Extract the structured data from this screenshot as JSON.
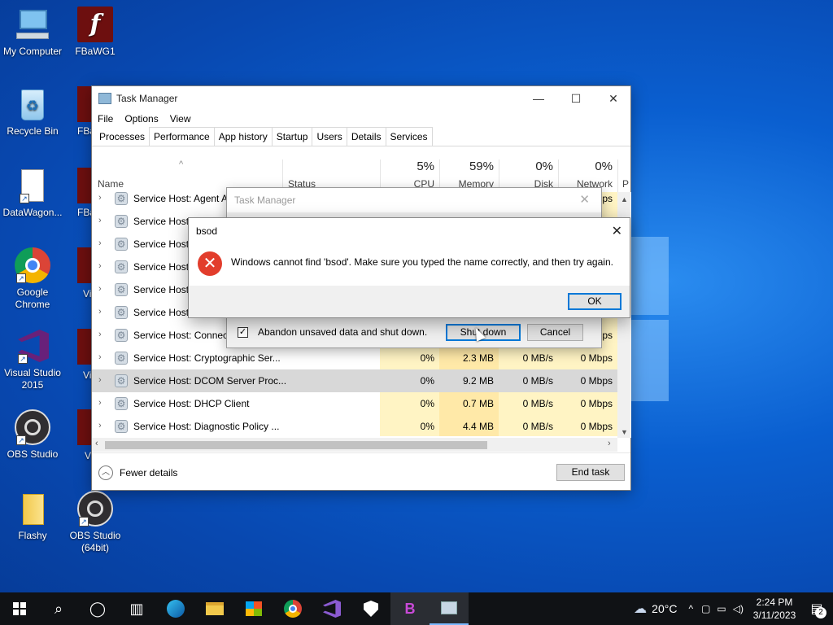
{
  "desktop": {
    "icons": [
      {
        "label": "My Computer"
      },
      {
        "label": "FBaWG1"
      },
      {
        "label": "Recycle Bin"
      },
      {
        "label": "DataWagon..."
      },
      {
        "label": "Google Chrome"
      },
      {
        "label": "Visual Studio 2015"
      },
      {
        "label": "OBS Studio"
      },
      {
        "label": "Flashy"
      },
      {
        "label": "OBS Studio (64bit)"
      }
    ],
    "partial_labels": [
      "FBa",
      "FBa",
      "Vi",
      "Vi",
      "V"
    ]
  },
  "task_manager": {
    "title": "Task Manager",
    "menu": [
      "File",
      "Options",
      "View"
    ],
    "tabs": [
      "Processes",
      "Performance",
      "App history",
      "Startup",
      "Users",
      "Details",
      "Services"
    ],
    "columns": {
      "name": "Name",
      "status": "Status",
      "cpu_pct": "5%",
      "cpu": "CPU",
      "mem_pct": "59%",
      "mem": "Memory",
      "disk_pct": "0%",
      "disk": "Disk",
      "net_pct": "0%",
      "net": "Network",
      "power": "P"
    },
    "rows": [
      {
        "name": "Service Host: Agent A",
        "net": "Mbps"
      },
      {
        "name": "Service Host: Audi"
      },
      {
        "name": "Service Host:"
      },
      {
        "name": "Service Host:"
      },
      {
        "name": "Service Host:"
      },
      {
        "name": "Service Host:"
      },
      {
        "name": "Service Host: Connect",
        "net": "Mbps"
      },
      {
        "name": "Service Host: Cryptographic Ser...",
        "cpu": "0%",
        "mem": "2.3 MB",
        "disk": "0 MB/s",
        "net": "0 Mbps"
      },
      {
        "name": "Service Host: DCOM Server Proc...",
        "cpu": "0%",
        "mem": "9.2 MB",
        "disk": "0 MB/s",
        "net": "0 Mbps"
      },
      {
        "name": "Service Host: DHCP Client",
        "cpu": "0%",
        "mem": "0.7 MB",
        "disk": "0 MB/s",
        "net": "0 Mbps"
      },
      {
        "name": "Service Host: Diagnostic Policy ...",
        "cpu": "0%",
        "mem": "4.4 MB",
        "disk": "0 MB/s",
        "net": "0 Mbps"
      }
    ],
    "fewer_details": "Fewer details",
    "end_task": "End task"
  },
  "shutdown_dialog": {
    "title": "Task Manager",
    "checkbox_label": "Abandon unsaved data and shut down.",
    "shutdown_label": "Shut down",
    "cancel_label": "Cancel"
  },
  "error_dialog": {
    "title": "bsod",
    "message": "Windows cannot find 'bsod'. Make sure you typed the name correctly, and then try again.",
    "ok_label": "OK"
  },
  "taskbar": {
    "weather": "20°C",
    "time": "2:24 PM",
    "date": "3/11/2023",
    "notifications": "2"
  },
  "colors": {
    "accent": "#0078d7",
    "error": "#e23d2c",
    "heat_light": "#fff4c4",
    "heat_dark": "#ffe9a8"
  }
}
